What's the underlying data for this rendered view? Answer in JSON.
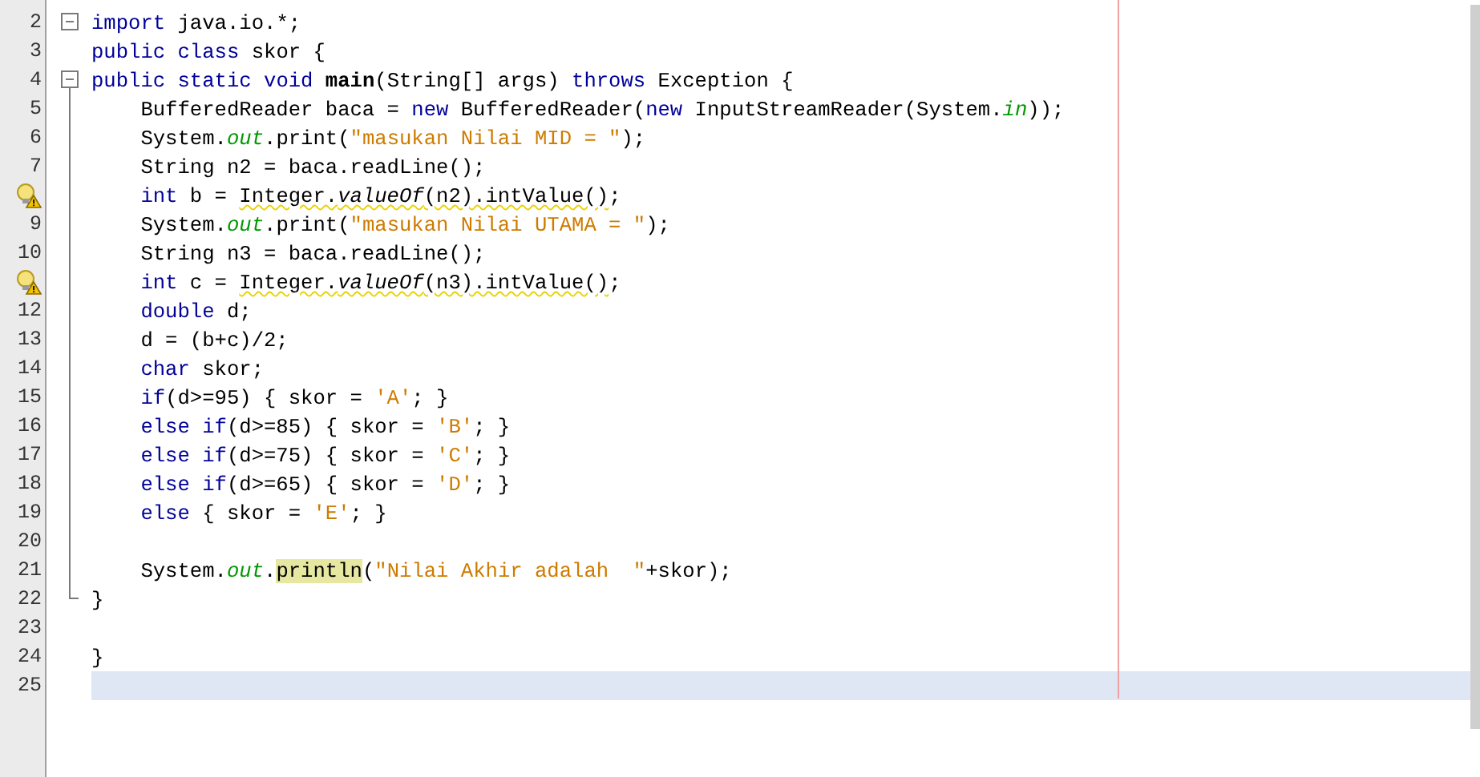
{
  "editor": {
    "lines": [
      {
        "number": "2",
        "warning": false,
        "current": false,
        "collapsible": true,
        "tokens": [
          {
            "kind": "kw",
            "text": "import"
          },
          {
            "kind": "plain",
            "text": " java.io.*;"
          }
        ]
      },
      {
        "number": "3",
        "warning": false,
        "current": false,
        "collapsible": false,
        "tokens": [
          {
            "kind": "kw",
            "text": "public class"
          },
          {
            "kind": "plain",
            "text": " skor {"
          }
        ]
      },
      {
        "number": "4",
        "warning": false,
        "current": false,
        "collapsible": true,
        "tokens": [
          {
            "kind": "kw",
            "text": "public static void "
          },
          {
            "kind": "bold",
            "text": "main"
          },
          {
            "kind": "plain",
            "text": "(String[] args) "
          },
          {
            "kind": "kw",
            "text": "throws"
          },
          {
            "kind": "plain",
            "text": " Exception {"
          }
        ],
        "children": [
          {
            "number": "5",
            "warning": false,
            "current": false,
            "tokens": [
              {
                "kind": "plain",
                "text": "BufferedReader baca = "
              },
              {
                "kind": "kw",
                "text": "new"
              },
              {
                "kind": "plain",
                "text": " BufferedReader("
              },
              {
                "kind": "kw",
                "text": "new"
              },
              {
                "kind": "plain",
                "text": " InputStreamReader(System."
              },
              {
                "kind": "field",
                "text": "in"
              },
              {
                "kind": "plain",
                "text": "));"
              }
            ]
          },
          {
            "number": "6",
            "warning": false,
            "current": false,
            "tokens": [
              {
                "kind": "plain",
                "text": "System."
              },
              {
                "kind": "field",
                "text": "out"
              },
              {
                "kind": "plain",
                "text": ".print("
              },
              {
                "kind": "str",
                "text": "\"masukan Nilai MID = \""
              },
              {
                "kind": "plain",
                "text": ");"
              }
            ]
          },
          {
            "number": "7",
            "warning": false,
            "current": false,
            "tokens": [
              {
                "kind": "plain",
                "text": "String n2 = baca.readLine();"
              }
            ]
          },
          {
            "warning": true,
            "current": false,
            "tokens": [
              {
                "kind": "kw",
                "text": "int"
              },
              {
                "kind": "plain",
                "text": " b = "
              },
              {
                "kind": "warn",
                "parts": [
                  {
                    "kind": "plain",
                    "text": "Integer."
                  },
                  {
                    "kind": "static",
                    "text": "valueOf"
                  },
                  {
                    "kind": "plain",
                    "text": "(n2).intValue()"
                  }
                ]
              },
              {
                "kind": "plain",
                "text": ";"
              }
            ]
          },
          {
            "number": "9",
            "warning": false,
            "current": false,
            "tokens": [
              {
                "kind": "plain",
                "text": "System."
              },
              {
                "kind": "field",
                "text": "out"
              },
              {
                "kind": "plain",
                "text": ".print("
              },
              {
                "kind": "str",
                "text": "\"masukan Nilai UTAMA = \""
              },
              {
                "kind": "plain",
                "text": ");"
              }
            ]
          },
          {
            "number": "10",
            "warning": false,
            "current": false,
            "tokens": [
              {
                "kind": "plain",
                "text": "String n3 = baca.readLine();"
              }
            ]
          },
          {
            "warning": true,
            "current": false,
            "tokens": [
              {
                "kind": "kw",
                "text": "int"
              },
              {
                "kind": "plain",
                "text": " c = "
              },
              {
                "kind": "warn",
                "parts": [
                  {
                    "kind": "plain",
                    "text": "Integer."
                  },
                  {
                    "kind": "static",
                    "text": "valueOf"
                  },
                  {
                    "kind": "plain",
                    "text": "(n3).intValue()"
                  }
                ]
              },
              {
                "kind": "plain",
                "text": ";"
              }
            ]
          },
          {
            "number": "12",
            "warning": false,
            "current": false,
            "tokens": [
              {
                "kind": "kw",
                "text": "double"
              },
              {
                "kind": "plain",
                "text": " d;"
              }
            ]
          },
          {
            "number": "13",
            "warning": false,
            "current": false,
            "tokens": [
              {
                "kind": "plain",
                "text": "d = (b+c)/2;"
              }
            ]
          },
          {
            "number": "14",
            "warning": false,
            "current": false,
            "tokens": [
              {
                "kind": "kw",
                "text": "char"
              },
              {
                "kind": "plain",
                "text": " skor;"
              }
            ]
          },
          {
            "number": "15",
            "warning": false,
            "current": false,
            "tokens": [
              {
                "kind": "kw",
                "text": "if"
              },
              {
                "kind": "plain",
                "text": "(d>=95) { skor = "
              },
              {
                "kind": "str",
                "text": "'A'"
              },
              {
                "kind": "plain",
                "text": "; }"
              }
            ]
          },
          {
            "number": "16",
            "warning": false,
            "current": false,
            "tokens": [
              {
                "kind": "kw",
                "text": "else if"
              },
              {
                "kind": "plain",
                "text": "(d>=85) { skor = "
              },
              {
                "kind": "str",
                "text": "'B'"
              },
              {
                "kind": "plain",
                "text": "; }"
              }
            ]
          },
          {
            "number": "17",
            "warning": false,
            "current": false,
            "tokens": [
              {
                "kind": "kw",
                "text": "else if"
              },
              {
                "kind": "plain",
                "text": "(d>=75) { skor = "
              },
              {
                "kind": "str",
                "text": "'C'"
              },
              {
                "kind": "plain",
                "text": "; }"
              }
            ]
          },
          {
            "number": "18",
            "warning": false,
            "current": false,
            "tokens": [
              {
                "kind": "kw",
                "text": "else if"
              },
              {
                "kind": "plain",
                "text": "(d>=65) { skor = "
              },
              {
                "kind": "str",
                "text": "'D'"
              },
              {
                "kind": "plain",
                "text": "; }"
              }
            ]
          },
          {
            "number": "19",
            "warning": false,
            "current": false,
            "tokens": [
              {
                "kind": "kw",
                "text": "else"
              },
              {
                "kind": "plain",
                "text": " { skor = "
              },
              {
                "kind": "str",
                "text": "'E'"
              },
              {
                "kind": "plain",
                "text": "; }"
              }
            ]
          },
          {
            "number": "20",
            "warning": false,
            "current": false
          },
          {
            "number": "21",
            "warning": false,
            "current": false,
            "tokens": [
              {
                "kind": "plain",
                "text": "System."
              },
              {
                "kind": "field",
                "text": "out"
              },
              {
                "kind": "plain",
                "text": "."
              },
              {
                "kind": "hl",
                "text": "println"
              },
              {
                "kind": "plain",
                "text": "("
              },
              {
                "kind": "str",
                "text": "\"Nilai Akhir adalah  \""
              },
              {
                "kind": "plain",
                "text": "+skor);"
              }
            ]
          }
        ],
        "close": {
          "number": "22",
          "warning": false,
          "current": false,
          "tokens": [
            {
              "kind": "plain",
              "text": "}"
            }
          ]
        }
      },
      {
        "number": "23",
        "warning": false,
        "current": false,
        "collapsible": false
      },
      {
        "number": "24",
        "warning": false,
        "current": false,
        "collapsible": false,
        "tokens": [
          {
            "kind": "plain",
            "text": "}"
          }
        ]
      },
      {
        "number": "25",
        "warning": false,
        "current": true,
        "collapsible": false
      }
    ]
  }
}
